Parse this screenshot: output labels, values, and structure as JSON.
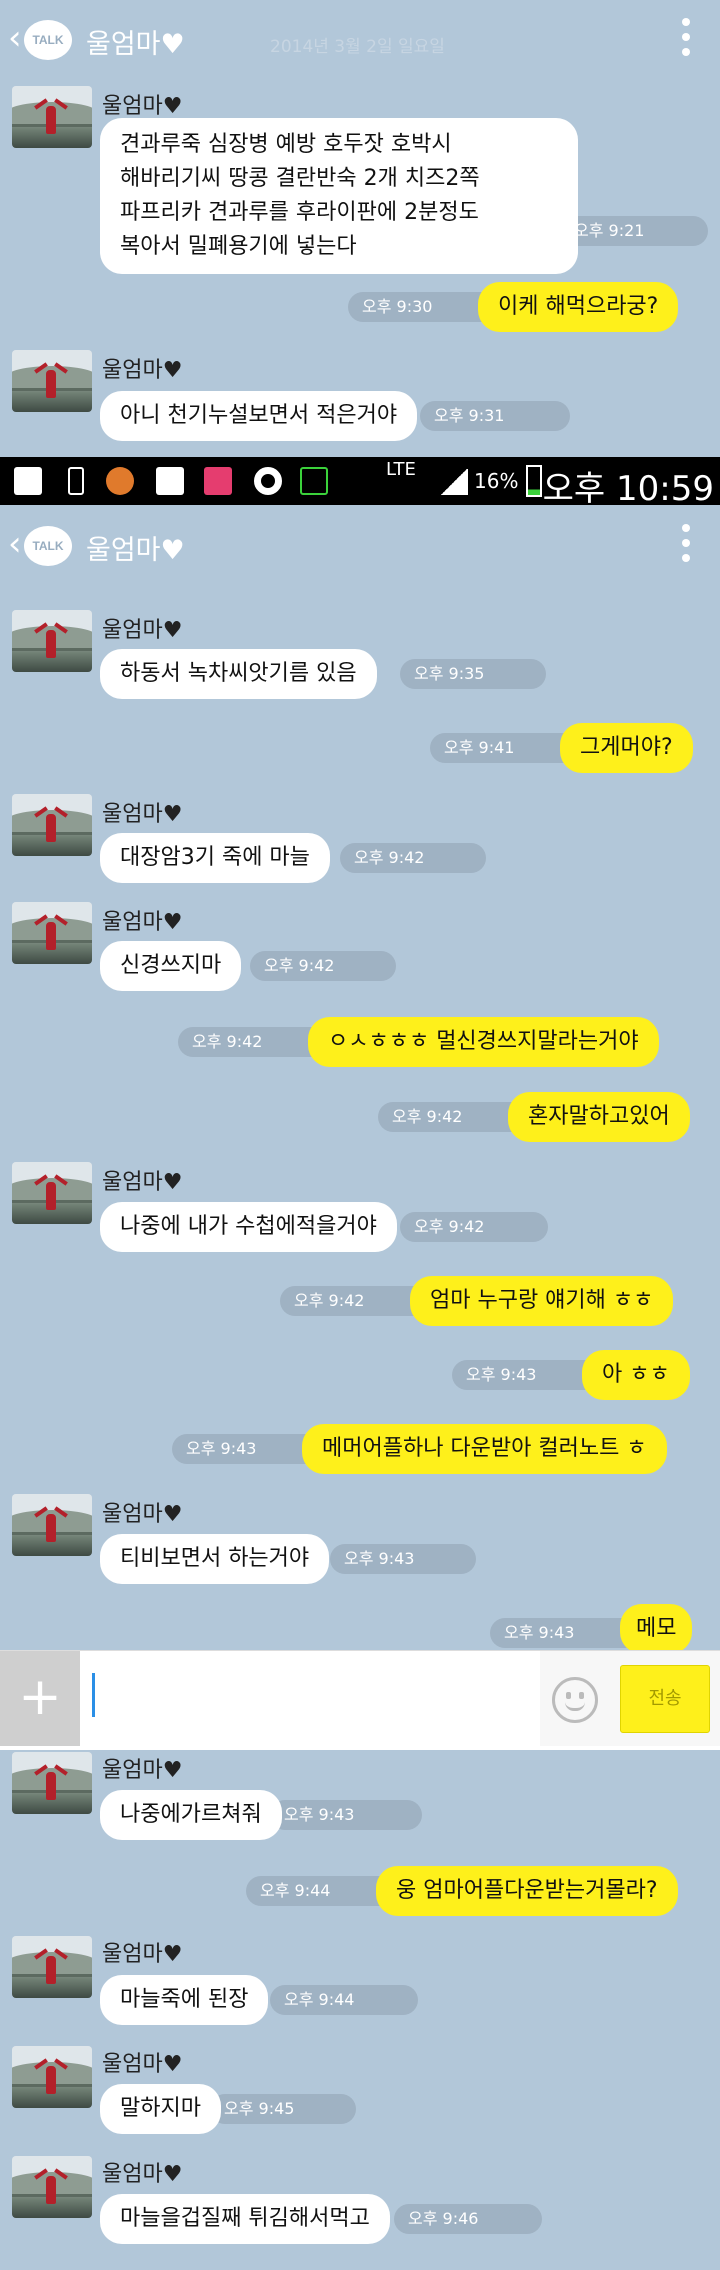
{
  "header": {
    "back_icon": "chevron-left-icon",
    "talk_badge": "TALK",
    "title": "울엄마♥",
    "date_banner": "2014년 3월 2일 일요일"
  },
  "sender_name": "울엄마♥",
  "section1": {
    "msg1": {
      "lines": [
        "견과루죽  심장병 예방    호두잣 호박시",
        "해바리기씨  땅콩 결란반숙 2개 치즈2쪽",
        "파프리카  견과루를 후라이판에 2분정도",
        "복아서 밀폐용기에 넣는다"
      ],
      "time": "오후 9:21"
    },
    "msg2": {
      "text": "이케  해먹으라궁?",
      "time": "오후 9:30"
    },
    "msg3": {
      "text": "아니 천기누설보면서 적은거야",
      "time": "오후 9:31"
    }
  },
  "statusbar": {
    "lte": "LTE",
    "battery": "16%",
    "clock": "오후 10:59"
  },
  "section2": {
    "m1": {
      "text": "하동서  녹차씨앗기름  있음",
      "time": "오후 9:35"
    },
    "m2": {
      "text": "그게머야?",
      "time": "오후 9:41"
    },
    "m3": {
      "text": "대장암3기  죽에 마늘",
      "time": "오후 9:42"
    },
    "m4": {
      "text": "신경쓰지마",
      "time": "오후 9:42"
    },
    "m5": {
      "text": "ㅇㅅㅎㅎㅎ 멀신경쓰지말라는거야",
      "time": "오후 9:42"
    },
    "m6": {
      "text": "혼자말하고있어",
      "time": "오후 9:42"
    },
    "m7": {
      "text": "나중에 내가 수첩에적을거야",
      "time": "오후 9:42"
    },
    "m8": {
      "text": "엄마 누구랑 얘기해 ㅎㅎ",
      "time": "오후 9:42"
    },
    "m9": {
      "text": "아 ㅎㅎ",
      "time": "오후 9:43"
    },
    "m10": {
      "text": "메머어플하나 다운받아 컬러노트 ㅎ",
      "time": "오후 9:43"
    },
    "m11": {
      "text": "티비보면서 하는거야",
      "time": "오후 9:43"
    },
    "m12": {
      "text": "메모",
      "time": "오후 9:43"
    }
  },
  "inputbar": {
    "plus_icon": "+",
    "placeholder": "",
    "send_label": "전송"
  },
  "section3": {
    "m1": {
      "text": "나중에가르쳐줘",
      "time": "오후 9:43"
    },
    "m2": {
      "text": "웅 엄마어플다운받는거몰라?",
      "time": "오후 9:44"
    },
    "m3": {
      "text": "마늘죽에  된장",
      "time": "오후 9:44"
    },
    "m4": {
      "text": "말하지마",
      "time": "오후 9:45"
    },
    "m5": {
      "text": "마늘을겁질째 튀김해서먹고",
      "time": "오후 9:46"
    }
  },
  "colors": {
    "background": "#b2c7d9",
    "my_bubble": "#fef01b",
    "their_bubble": "#ffffff",
    "time_pill": "#9fb2c3"
  }
}
